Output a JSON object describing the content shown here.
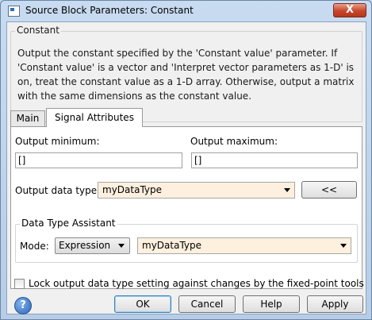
{
  "window": {
    "title": "Source Block Parameters: Constant",
    "close_label": "X"
  },
  "description": {
    "heading": "Constant",
    "text": "Output the constant specified by the 'Constant value' parameter. If 'Constant value' is a vector and 'Interpret vector parameters as 1-D' is on, treat the constant value as a 1-D array. Otherwise, output a matrix with the same dimensions as the constant value."
  },
  "tabs": [
    {
      "label": "Main",
      "active": false
    },
    {
      "label": "Signal Attributes",
      "active": true
    }
  ],
  "signal_attributes": {
    "output_minimum_label": "Output minimum:",
    "output_minimum_value": "[]",
    "output_maximum_label": "Output maximum:",
    "output_maximum_value": "[]",
    "output_data_type_label": "Output data type:",
    "output_data_type_value": "myDataType",
    "assistant_toggle_label": "<<",
    "assistant": {
      "heading": "Data Type Assistant",
      "mode_label": "Mode:",
      "mode_value": "Expression",
      "expression_value": "myDataType"
    },
    "lock_label": "Lock output data type setting against changes by the fixed-point tools",
    "lock_checked": false
  },
  "buttons": {
    "help_icon": "?",
    "ok": "OK",
    "cancel": "Cancel",
    "help": "Help",
    "apply": "Apply"
  }
}
